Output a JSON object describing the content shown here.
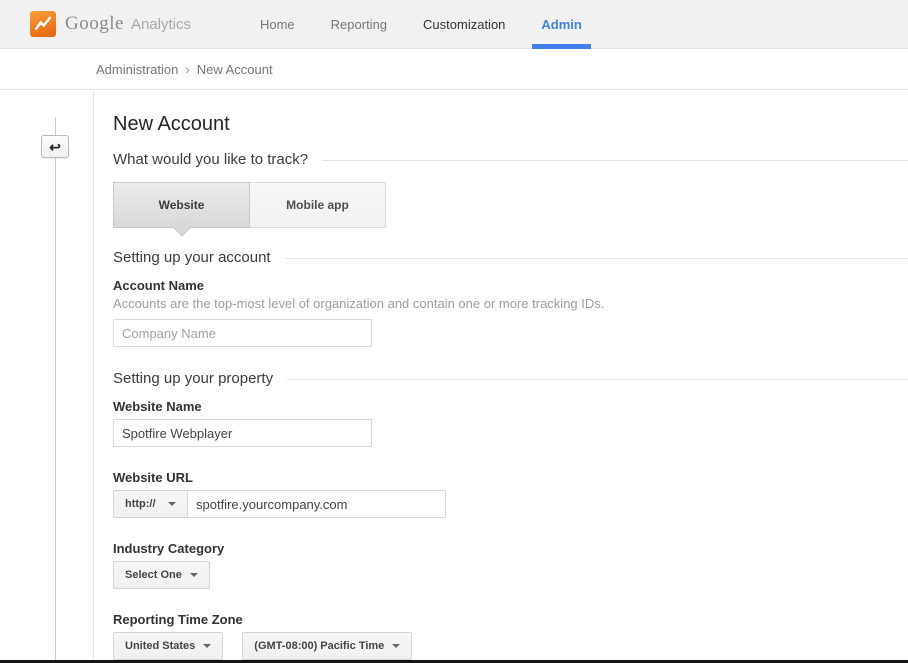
{
  "header": {
    "logo": {
      "brand": "Google",
      "product": "Analytics"
    },
    "nav": [
      {
        "label": "Home"
      },
      {
        "label": "Reporting"
      },
      {
        "label": "Customization"
      },
      {
        "label": "Admin"
      }
    ]
  },
  "breadcrumb": {
    "items": [
      "Administration",
      "New Account"
    ],
    "separator": "›"
  },
  "page": {
    "title": "New Account",
    "track_section": {
      "title": "What would you like to track?"
    },
    "tabs": [
      {
        "label": "Website",
        "active": true
      },
      {
        "label": "Mobile app",
        "active": false
      }
    ],
    "account_section": {
      "title": "Setting up your account",
      "account_name_label": "Account Name",
      "account_name_help": "Accounts are the top-most level of organization and contain one or more tracking IDs.",
      "account_name_placeholder": "Company Name"
    },
    "property_section": {
      "title": "Setting up your property",
      "website_name_label": "Website Name",
      "website_name_value": "Spotfire Webplayer",
      "website_url_label": "Website URL",
      "url_scheme": "http://",
      "website_url_value": "spotfire.yourcompany.com",
      "industry_label": "Industry Category",
      "industry_value": "Select One",
      "timezone_label": "Reporting Time Zone",
      "timezone_country": "United States",
      "timezone_value": "(GMT-08:00) Pacific Time"
    }
  },
  "colors": {
    "accent_blue": "#427fed",
    "logo_orange": "#ef7c1a",
    "active_tab_gray": "#d8d8d8"
  }
}
